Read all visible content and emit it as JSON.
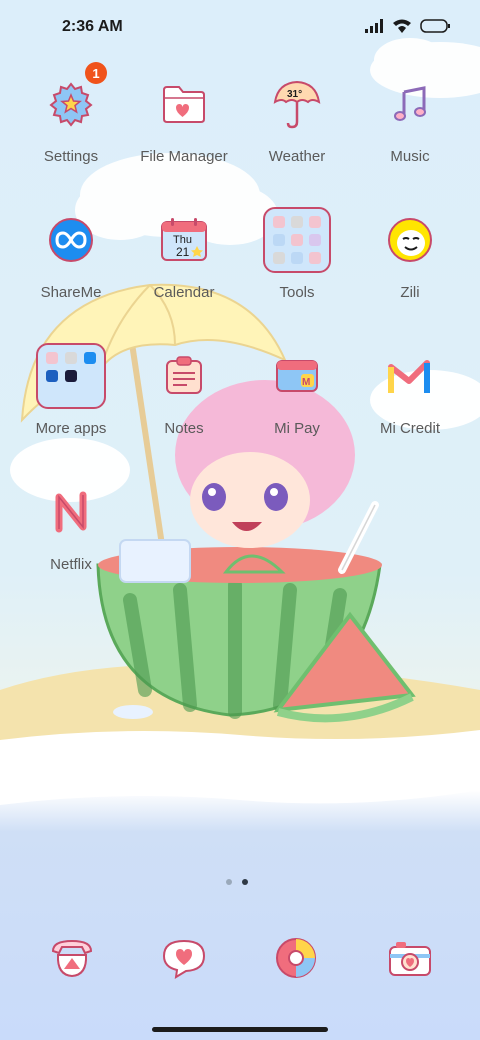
{
  "status_bar": {
    "time": "2:36 AM"
  },
  "apps": [
    {
      "label": "Settings",
      "icon": "settings-icon",
      "badge": "1"
    },
    {
      "label": "File Manager",
      "icon": "folder-icon"
    },
    {
      "label": "Weather",
      "icon": "umbrella-icon",
      "temperature": "31°"
    },
    {
      "label": "Music",
      "icon": "music-note-icon"
    },
    {
      "label": "ShareMe",
      "icon": "shareme-icon"
    },
    {
      "label": "Calendar",
      "icon": "calendar-icon",
      "day": "Thu",
      "date": "21"
    },
    {
      "label": "Tools",
      "icon": "tools-folder-icon"
    },
    {
      "label": "Zili",
      "icon": "zili-face-icon"
    },
    {
      "label": "More apps",
      "icon": "more-apps-folder-icon"
    },
    {
      "label": "Notes",
      "icon": "notes-icon"
    },
    {
      "label": "Mi Pay",
      "icon": "mi-pay-icon"
    },
    {
      "label": "Mi Credit",
      "icon": "mi-credit-icon"
    },
    {
      "label": "Netflix",
      "icon": "netflix-icon"
    }
  ],
  "dock": [
    {
      "icon": "phone-icon"
    },
    {
      "icon": "messages-icon"
    },
    {
      "icon": "browser-icon"
    },
    {
      "icon": "camera-icon"
    }
  ],
  "page_indicator": {
    "pages": 2,
    "active": 2
  },
  "colors": {
    "accent": "#c74a6a",
    "badge": "#f0531b",
    "label": "#5a5a5a"
  }
}
